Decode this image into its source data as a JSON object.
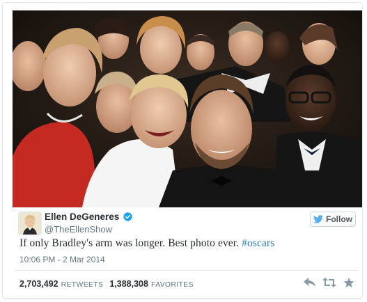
{
  "tweet": {
    "display_name": "Ellen DeGeneres",
    "handle": "@TheEllenShow",
    "text_main": "If only Bradley's arm was longer. Best photo ever.",
    "hashtag": "#oscars",
    "timestamp": "10:06 PM - 2 Mar 2014",
    "retweets_count": "2,703,492",
    "retweets_label": "RETWEETS",
    "favorites_count": "1,388,308",
    "favorites_label": "FAVORITES",
    "follow_label": "Follow"
  },
  "colors": {
    "link": "#2b7bb9",
    "verified": "#1da1f2",
    "twitter_blue": "#55acee",
    "muted": "#66757f"
  },
  "icons": [
    "verified-icon",
    "twitter-bird-icon",
    "reply-icon",
    "retweet-icon",
    "favorite-icon"
  ]
}
